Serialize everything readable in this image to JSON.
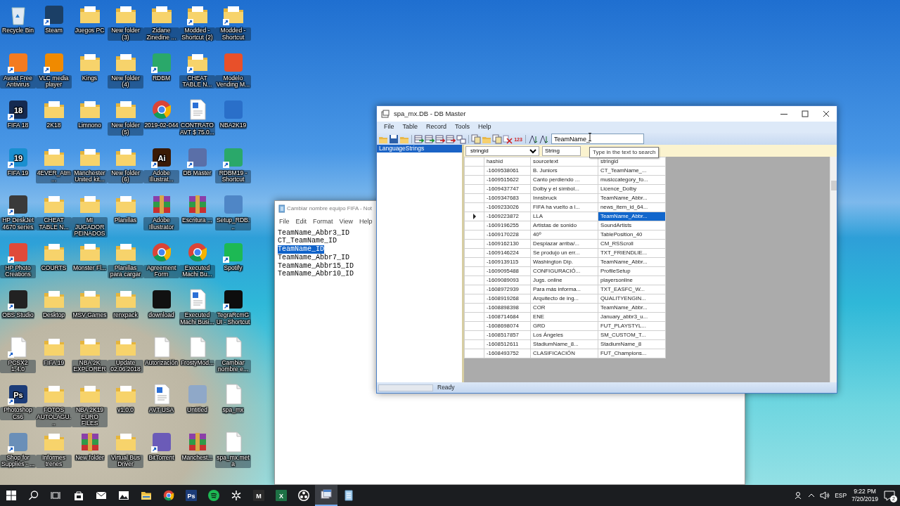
{
  "desktop": {
    "icons": [
      {
        "label": "Recycle Bin",
        "kind": "recycle",
        "shortcut": false
      },
      {
        "label": "Steam",
        "kind": "app",
        "color": "#1b3f66",
        "shortcut": true
      },
      {
        "label": "Juegos PC",
        "kind": "folder",
        "shortcut": false
      },
      {
        "label": "New folder (3)",
        "kind": "folder",
        "shortcut": false
      },
      {
        "label": "Zidane Zinedine ...",
        "kind": "folder",
        "shortcut": false
      },
      {
        "label": "Modded - Shortcut (2)",
        "kind": "folder",
        "shortcut": true
      },
      {
        "label": "Modded - Shortcut",
        "kind": "folder",
        "shortcut": true
      },
      {
        "label": "Avast Free Antivirus",
        "kind": "app",
        "color": "#f47b20",
        "shortcut": true
      },
      {
        "label": "VLC media player",
        "kind": "app",
        "color": "#f08a00",
        "shortcut": true
      },
      {
        "label": "Kings",
        "kind": "folder",
        "shortcut": false
      },
      {
        "label": "New folder (4)",
        "kind": "folder",
        "shortcut": false
      },
      {
        "label": "RDBM",
        "kind": "app",
        "color": "#2aa86a",
        "shortcut": true
      },
      {
        "label": "CHEAT TABLE N...",
        "kind": "folder",
        "shortcut": true
      },
      {
        "label": "Modelo Vending M...",
        "kind": "app",
        "color": "#e8502a",
        "shortcut": false
      },
      {
        "label": "FIFA 18",
        "kind": "app",
        "color": "#152a50",
        "glyph": "18",
        "shortcut": true
      },
      {
        "label": "2K18",
        "kind": "folder",
        "shortcut": false
      },
      {
        "label": "Limnono",
        "kind": "folder",
        "shortcut": false
      },
      {
        "label": "New folder (5)",
        "kind": "folder",
        "shortcut": false
      },
      {
        "label": "2019-02-044",
        "kind": "chrome",
        "shortcut": false
      },
      {
        "label": "CONTRATO AVT  $ 75.0...",
        "kind": "document",
        "shortcut": false
      },
      {
        "label": "NBA2K19",
        "kind": "app",
        "color": "#2a6fc9",
        "shortcut": false
      },
      {
        "label": "FIFA 19",
        "kind": "app",
        "color": "#1a8fd0",
        "glyph": "19",
        "shortcut": true
      },
      {
        "label": "4EVER_Atm...",
        "kind": "folder",
        "shortcut": false
      },
      {
        "label": "Manchester United kit...",
        "kind": "folder",
        "shortcut": false
      },
      {
        "label": "New folder (6)",
        "kind": "folder",
        "shortcut": false
      },
      {
        "label": "Adobe Illustrat...",
        "kind": "app",
        "color": "#3a1a05",
        "glyph": "Ai",
        "shortcut": true
      },
      {
        "label": "DB Master",
        "kind": "app",
        "color": "#5a6fa8",
        "shortcut": true
      },
      {
        "label": "RDBM19 - Shortcut",
        "kind": "app",
        "color": "#2aa86a",
        "shortcut": true
      },
      {
        "label": "HP DeskJet 4670 series",
        "kind": "app",
        "color": "#3a3a3a",
        "shortcut": true
      },
      {
        "label": "CHEAT TABLE N...",
        "kind": "folder",
        "shortcut": false
      },
      {
        "label": "MI JUGADOR PEINADOS",
        "kind": "folder",
        "shortcut": false
      },
      {
        "label": "Planillas",
        "kind": "folder",
        "shortcut": false
      },
      {
        "label": "Adobe Illustrator",
        "kind": "archive",
        "shortcut": false
      },
      {
        "label": "Escritura ...",
        "kind": "archive",
        "shortcut": false
      },
      {
        "label": "Setup_RDB...",
        "kind": "app",
        "color": "#4f86c6",
        "shortcut": false
      },
      {
        "label": "HP Photo Creations",
        "kind": "app",
        "color": "#e04a3a",
        "shortcut": true
      },
      {
        "label": "COURTS",
        "kind": "folder",
        "shortcut": false
      },
      {
        "label": "Monster Fl...",
        "kind": "folder",
        "shortcut": false
      },
      {
        "label": "Planillas para cargar",
        "kind": "folder",
        "shortcut": false
      },
      {
        "label": "Agreement Form",
        "kind": "chrome",
        "shortcut": false
      },
      {
        "label": "Executed Machi Bu...",
        "kind": "chrome",
        "shortcut": false
      },
      {
        "label": "Spotify",
        "kind": "app",
        "color": "#1db954",
        "shortcut": true
      },
      {
        "label": "OBS Studio",
        "kind": "app",
        "color": "#222222",
        "shortcut": true
      },
      {
        "label": "Desktop",
        "kind": "folder",
        "shortcut": false
      },
      {
        "label": "MSV Games",
        "kind": "folder",
        "shortcut": false
      },
      {
        "label": "renxpack",
        "kind": "folder",
        "shortcut": false
      },
      {
        "label": "download",
        "kind": "app",
        "color": "#111111",
        "shortcut": false
      },
      {
        "label": "Executed Machi Busi...",
        "kind": "document",
        "shortcut": false
      },
      {
        "label": "TegraRcmGUI - Shortcut",
        "kind": "app",
        "color": "#0d0d0d",
        "shortcut": true
      },
      {
        "label": "PCSX2 1.4.0",
        "kind": "file",
        "shortcut": true
      },
      {
        "label": "FIFA 19",
        "kind": "folder",
        "shortcut": false
      },
      {
        "label": "NBA 2K EXPLORER",
        "kind": "folder",
        "shortcut": false
      },
      {
        "label": "Update 02.06.2018",
        "kind": "folder",
        "shortcut": false
      },
      {
        "label": "Autorización",
        "kind": "file",
        "shortcut": false
      },
      {
        "label": "FrostyMod...",
        "kind": "file",
        "shortcut": false
      },
      {
        "label": "Cambiar nombre e...",
        "kind": "file",
        "shortcut": false
      },
      {
        "label": "Photoshop Cs6",
        "kind": "app",
        "color": "#1c3c78",
        "glyph": "Ps",
        "shortcut": true
      },
      {
        "label": "FOTOS AUTOLAGU...",
        "kind": "folder",
        "shortcut": false
      },
      {
        "label": "NBA 2K19 EURO FILES",
        "kind": "folder",
        "shortcut": false
      },
      {
        "label": "v1.0.0",
        "kind": "folder",
        "shortcut": false
      },
      {
        "label": "AVT USA",
        "kind": "document",
        "shortcut": false
      },
      {
        "label": "Untitled",
        "kind": "app",
        "color": "#8fa8c8",
        "shortcut": false
      },
      {
        "label": "spa_mx",
        "kind": "file",
        "shortcut": false
      },
      {
        "label": "Shop for Supplies - ...",
        "kind": "app",
        "color": "#6a8fb8",
        "shortcut": true
      },
      {
        "label": "Informes trenes",
        "kind": "folder",
        "shortcut": false
      },
      {
        "label": "New folder",
        "kind": "archive",
        "shortcut": false
      },
      {
        "label": "Virtual Bus Driver",
        "kind": "folder",
        "shortcut": false
      },
      {
        "label": "BitTorrent",
        "kind": "app",
        "color": "#6b5bb8",
        "shortcut": true
      },
      {
        "label": "Manchest...",
        "kind": "archive",
        "shortcut": false
      },
      {
        "label": "spa_mx.meta",
        "kind": "file",
        "shortcut": false
      }
    ]
  },
  "notepad": {
    "title": "Cambiar nombre equipo FIFA - Not",
    "menu": [
      "File",
      "Edit",
      "Format",
      "View",
      "Help"
    ],
    "lines": [
      {
        "text": "TeamName_Abbr3_ID",
        "selected": false
      },
      {
        "text": "CT_TeamName_ID",
        "selected": false
      },
      {
        "text": "TeamName_ID",
        "selected": true
      },
      {
        "text": "TeamName_Abbr7_ID",
        "selected": false
      },
      {
        "text": "TeamName_Abbr15_ID",
        "selected": false
      },
      {
        "text": "TeamName_Abbr10_ID",
        "selected": false
      }
    ]
  },
  "db_master": {
    "title": "spa_mx.DB - DB Master",
    "menu": [
      "File",
      "Table",
      "Record",
      "Tools",
      "Help"
    ],
    "toolbar": [
      {
        "kind": "folder"
      },
      {
        "kind": "disk"
      },
      {
        "kind": "folder"
      },
      {
        "kind": "grid-in"
      },
      {
        "kind": "grid-in"
      },
      {
        "kind": "grid-out"
      },
      {
        "kind": "grid-out"
      },
      {
        "kind": "grid-link"
      },
      {
        "kind": "copy"
      },
      {
        "kind": "folder"
      },
      {
        "kind": "copy"
      },
      {
        "kind": "delete"
      },
      {
        "kind": "glyph",
        "glyph": "123"
      },
      {
        "kind": "sort"
      },
      {
        "kind": "sort"
      }
    ],
    "search": {
      "value": "TeamName_"
    },
    "tree": [
      {
        "label": "LanguageStrings",
        "selected": true
      }
    ],
    "filter": {
      "column": "stringid",
      "type": "String"
    },
    "tooltip": "Type in the text to search",
    "table": {
      "columns": [
        "hashid",
        "sourcetext",
        "stringid"
      ],
      "rows": [
        {
          "cells": [
            "-1609538061",
            "B. Juniors",
            "CT_TeamName_..."
          ],
          "selected": false
        },
        {
          "cells": [
            "-1609515622",
            "Canto perdiendo ...",
            "musiccategory_fo..."
          ],
          "selected": false
        },
        {
          "cells": [
            "-1609437747",
            "Dolby y el símbol...",
            "Licence_Dolby"
          ],
          "selected": false
        },
        {
          "cells": [
            "-1609347683",
            "Innsbruck",
            "TeamName_Abbr..."
          ],
          "selected": false
        },
        {
          "cells": [
            "-1609233026",
            "FIFA ha vuelto a l...",
            "news_item_id_64..."
          ],
          "selected": false
        },
        {
          "cells": [
            "-1609223872",
            "LLA",
            "TeamName_Abbr..."
          ],
          "selected": true
        },
        {
          "cells": [
            "-1609196255",
            "Artistas de sonido",
            "SoundArtists"
          ],
          "selected": false
        },
        {
          "cells": [
            "-1609170228",
            "40º",
            "TablePosition_40"
          ],
          "selected": false
        },
        {
          "cells": [
            "-1609162130",
            "Desplazar arriba/...",
            "CM_RSScroll"
          ],
          "selected": false
        },
        {
          "cells": [
            "-1609146224",
            "Se produjo un err...",
            "TXT_FRIENDLIE..."
          ],
          "selected": false
        },
        {
          "cells": [
            "-1609139115",
            "Washington Dip.",
            "TeamName_Abbr..."
          ],
          "selected": false
        },
        {
          "cells": [
            "-1609095488",
            "CONFIGURACIÓ...",
            "ProfileSetup"
          ],
          "selected": false
        },
        {
          "cells": [
            "-1609089093",
            "Jugs. online",
            "playersonline"
          ],
          "selected": false
        },
        {
          "cells": [
            "-1608972939",
            "Para más informa...",
            "TXT_EASFC_W..."
          ],
          "selected": false
        },
        {
          "cells": [
            "-1608919268",
            "Arquitecto de ing...",
            "QUALITYENGIN..."
          ],
          "selected": false
        },
        {
          "cells": [
            "-1608898398",
            "COR",
            "TeamName_Abbr..."
          ],
          "selected": false
        },
        {
          "cells": [
            "-1608714684",
            "ENE",
            "January_abbr3_u..."
          ],
          "selected": false
        },
        {
          "cells": [
            "-1608698074",
            "GRD",
            "FUT_PLAYSTYL..."
          ],
          "selected": false
        },
        {
          "cells": [
            "-1608517857",
            "Los Ángeles",
            "SM_CUSTOM_T..."
          ],
          "selected": false
        },
        {
          "cells": [
            "-1608512611",
            "StadiumName_8...",
            "StadiumName_8"
          ],
          "selected": false
        },
        {
          "cells": [
            "-1608493752",
            "CLASIFICACIÓN",
            "FUT_Champions..."
          ],
          "selected": false
        }
      ]
    },
    "status": "Ready"
  },
  "taskbar": {
    "apps": [
      {
        "kind": "windows",
        "selected": false
      },
      {
        "kind": "search",
        "selected": false
      },
      {
        "kind": "taskview",
        "selected": false
      },
      {
        "kind": "store",
        "selected": false
      },
      {
        "kind": "mail",
        "selected": false
      },
      {
        "kind": "photos",
        "selected": false
      },
      {
        "kind": "explorer",
        "selected": false
      },
      {
        "kind": "chrome",
        "selected": false
      },
      {
        "kind": "tile",
        "glyph": "Ps",
        "color": "#1c3c78",
        "selected": false
      },
      {
        "kind": "spotify",
        "selected": false
      },
      {
        "kind": "gear",
        "selected": false
      },
      {
        "kind": "tile",
        "glyph": "M",
        "color": "#2b2b2b",
        "selected": false
      },
      {
        "kind": "tile",
        "glyph": "X",
        "color": "#1e7145",
        "selected": false
      },
      {
        "kind": "obs",
        "selected": false
      },
      {
        "kind": "window",
        "selected": true
      },
      {
        "kind": "notepad",
        "selected": false
      }
    ],
    "language": "ESP",
    "time": "9:22 PM",
    "date": "7/20/2019",
    "notifications": "2"
  }
}
